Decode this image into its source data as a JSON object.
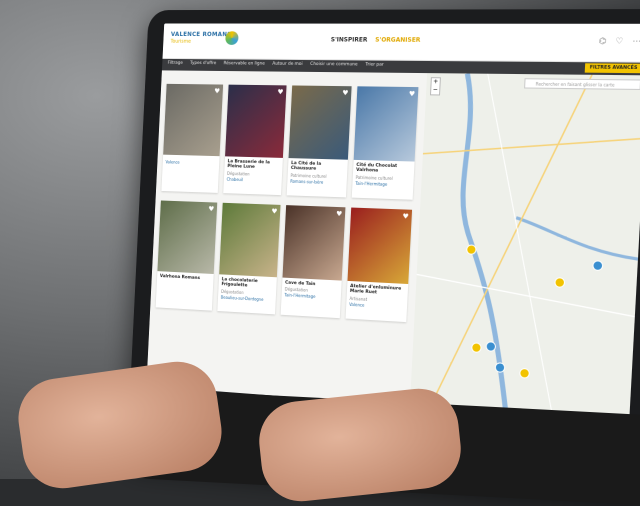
{
  "site": {
    "logo_line1": "VALENCE ROMANS",
    "logo_line2": "Tourisme"
  },
  "topnav": {
    "inspirer": "S'INSPIRER",
    "organiser": "S'ORGANISER"
  },
  "filters": {
    "items": [
      "Filtrage",
      "Types d'offre",
      "Réservable en ligne",
      "Autour de moi",
      "Choisir une commune",
      "Trier par"
    ],
    "advanced": "FILTRES AVANCÉS"
  },
  "map": {
    "search_placeholder": "Rechercher en faisant glisser la carte"
  },
  "cards": [
    {
      "title": "",
      "category": "",
      "city": "Valence",
      "colors": [
        "#6b6a64",
        "#a89f8e"
      ]
    },
    {
      "title": "La Brasserie de la Pleine Lune",
      "category": "Dégustation",
      "city": "Chabeuil",
      "colors": [
        "#2b2f4a",
        "#8a2a3a"
      ]
    },
    {
      "title": "La Cité de la Chaussure",
      "category": "Patrimoine culturel",
      "city": "Romans-sur-Isère",
      "colors": [
        "#7a6a4a",
        "#3a5a7a"
      ]
    },
    {
      "title": "Cité du Chocolat Valrhona",
      "category": "Patrimoine culturel",
      "city": "Tain-l'Hermitage",
      "colors": [
        "#4a78a8",
        "#b7c9dc"
      ]
    },
    {
      "title": "Valrhona Romans",
      "category": "",
      "city": "",
      "colors": [
        "#5f6e4a",
        "#b8b8a8"
      ]
    },
    {
      "title": "La chocolaterie Frigoulette",
      "category": "Dégustation",
      "city": "Beaulieu-sur-Dordogne",
      "colors": [
        "#5d7a3a",
        "#c8b38a"
      ]
    },
    {
      "title": "Cave de Tain",
      "category": "Dégustation",
      "city": "Tain-l'Hermitage",
      "colors": [
        "#4a3228",
        "#c8a890"
      ]
    },
    {
      "title": "Atelier d'enluminure Marie Ruet",
      "category": "Artisanat",
      "city": "Valence",
      "colors": [
        "#9a1e1e",
        "#d8a838"
      ]
    }
  ],
  "ui_colors": {
    "accent": "#f2c300",
    "filterbar": "#3a3b3e",
    "link": "#2a6fa5"
  }
}
